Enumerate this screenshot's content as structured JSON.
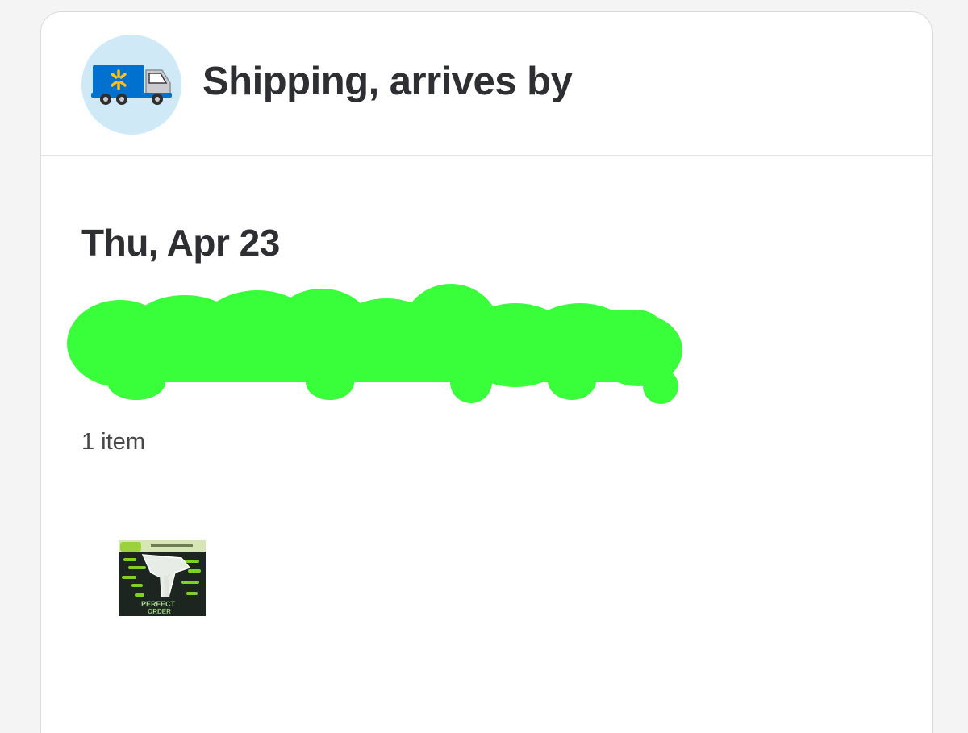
{
  "header": {
    "title": "Shipping, arrives by",
    "icon": "walmart-delivery-truck-icon"
  },
  "delivery": {
    "date": "Thu, Apr 23",
    "item_count": "1 item"
  },
  "product": {
    "thumbnail_icon": "product-box-thumbnail",
    "box_text_lines": [
      "PERFECT",
      "ORDER"
    ]
  },
  "colors": {
    "title_text": "#2e2f32",
    "badge_background": "#cfe9f7",
    "truck_blue": "#0071ce",
    "spark_yellow": "#ffc220",
    "redaction_green": "#38ff3a",
    "card_border": "#dadbdd"
  }
}
